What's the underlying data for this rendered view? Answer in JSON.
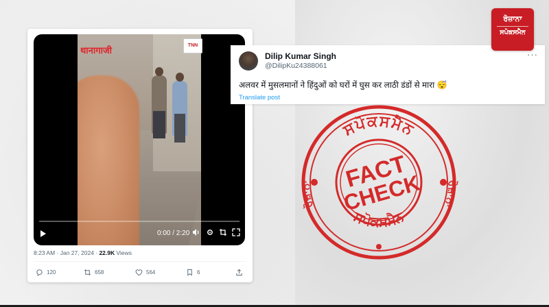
{
  "tweet": {
    "video": {
      "overlay_place_text": "थानागाजी",
      "channel_logo_text": "TNN",
      "time": "0:00 / 2:20",
      "progress": 0
    },
    "timestamp": "8:23 AM · Jan 27, 2024 · ",
    "views_count": "22.9K",
    "views_label": " Views",
    "actions": {
      "replies": "120",
      "reposts": "658",
      "likes": "564",
      "bookmarks": "6"
    }
  },
  "quote": {
    "name": "Dilip Kumar Singh",
    "handle": "@DilipKu24388061",
    "text": "अलवर में मुसलमानों ने हिंदुओं को घरों में घुस कर लाठी डंडों से मारा 😴",
    "translate": "Translate post",
    "menu": "···"
  },
  "brand": {
    "line1": "ਰੋਜ਼ਾਨਾ",
    "line2": "ਸਪੋਕਸਮੈਨ"
  },
  "stamp": {
    "top_arc": "ਸਪੋਕਸਮੈਨ",
    "left_arc": "ਰੋਜ਼ਾਨਾ",
    "right_arc": "ਰੋਜ਼ਾਨਾ",
    "bottom_arc": "ਸਪੋਕਸਮੈਨ",
    "center_line1": "FACT",
    "center_line2": "CHECK",
    "color": "#d42a2a"
  }
}
